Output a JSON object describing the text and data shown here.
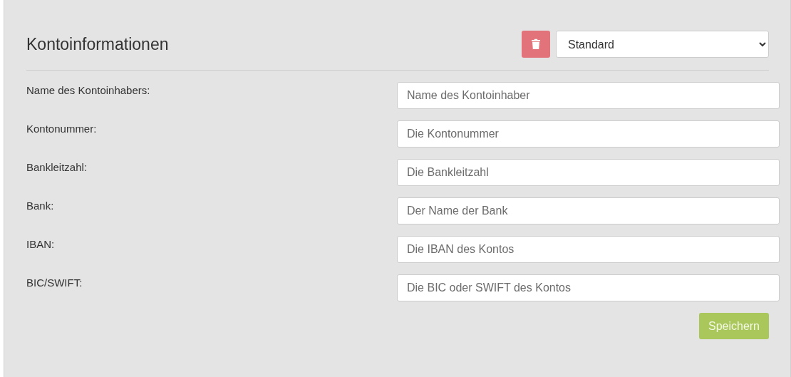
{
  "title": "Kontoinformationen",
  "profile_select": {
    "value": "Standard"
  },
  "fields": [
    {
      "label": "Name des Kontoinhabers:",
      "placeholder": "Name des Kontoinhaber"
    },
    {
      "label": "Kontonummer:",
      "placeholder": "Die Kontonummer"
    },
    {
      "label": "Bankleitzahl:",
      "placeholder": "Die Bankleitzahl"
    },
    {
      "label": "Bank:",
      "placeholder": "Der Name der Bank"
    },
    {
      "label": "IBAN:",
      "placeholder": "Die IBAN des Kontos"
    },
    {
      "label": "BIC/SWIFT:",
      "placeholder": "Die BIC oder SWIFT des Kontos"
    }
  ],
  "save_button": "Speichern"
}
